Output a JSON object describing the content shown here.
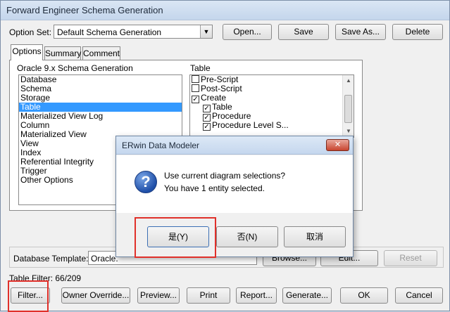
{
  "window": {
    "title": "Forward Engineer Schema Generation"
  },
  "option_set": {
    "label": "Option Set:",
    "value": "Default Schema Generation",
    "buttons": {
      "open": "Open...",
      "save": "Save",
      "save_as": "Save As...",
      "delete": "Delete"
    }
  },
  "tabs": [
    "Options",
    "Summary",
    "Comment"
  ],
  "left_list": {
    "header": "Oracle 9.x Schema Generation",
    "items": [
      "Database",
      "Schema",
      "Storage",
      "Table",
      "Materialized View Log",
      "Column",
      "Materialized View",
      "View",
      "Index",
      "Referential Integrity",
      "Trigger",
      "Other Options"
    ],
    "selected": "Table"
  },
  "right_list": {
    "header": "Table",
    "items": [
      {
        "label": "Pre-Script",
        "checked": false,
        "indent": 0
      },
      {
        "label": "Post-Script",
        "checked": false,
        "indent": 0
      },
      {
        "label": "Create",
        "checked": true,
        "indent": 0
      },
      {
        "label": "Table",
        "checked": true,
        "indent": 1
      },
      {
        "label": "Procedure",
        "checked": true,
        "indent": 1
      },
      {
        "label": "Procedure Level S...",
        "checked": true,
        "indent": 1
      }
    ]
  },
  "database_template": {
    "label": "Database Template:",
    "value": "Oracle.",
    "browse": "Browse...",
    "edit": "Edit...",
    "reset": "Reset"
  },
  "table_filter": "Table Filter: 66/209",
  "bottom_buttons": {
    "filter": "Filter...",
    "owner_override": "Owner Override...",
    "preview": "Preview...",
    "print": "Print",
    "report": "Report...",
    "generate": "Generate...",
    "ok": "OK",
    "cancel": "Cancel"
  },
  "dialog": {
    "title": "ERwin Data Modeler",
    "close": "✕",
    "icon": "question-icon",
    "message_line1": "Use current diagram selections?",
    "message_line2": "You have 1 entity selected.",
    "buttons": {
      "yes": "是(Y)",
      "no": "否(N)",
      "cancel": "取消"
    }
  },
  "colors": {
    "highlight": "#e0302a",
    "selection": "#3399ff"
  }
}
